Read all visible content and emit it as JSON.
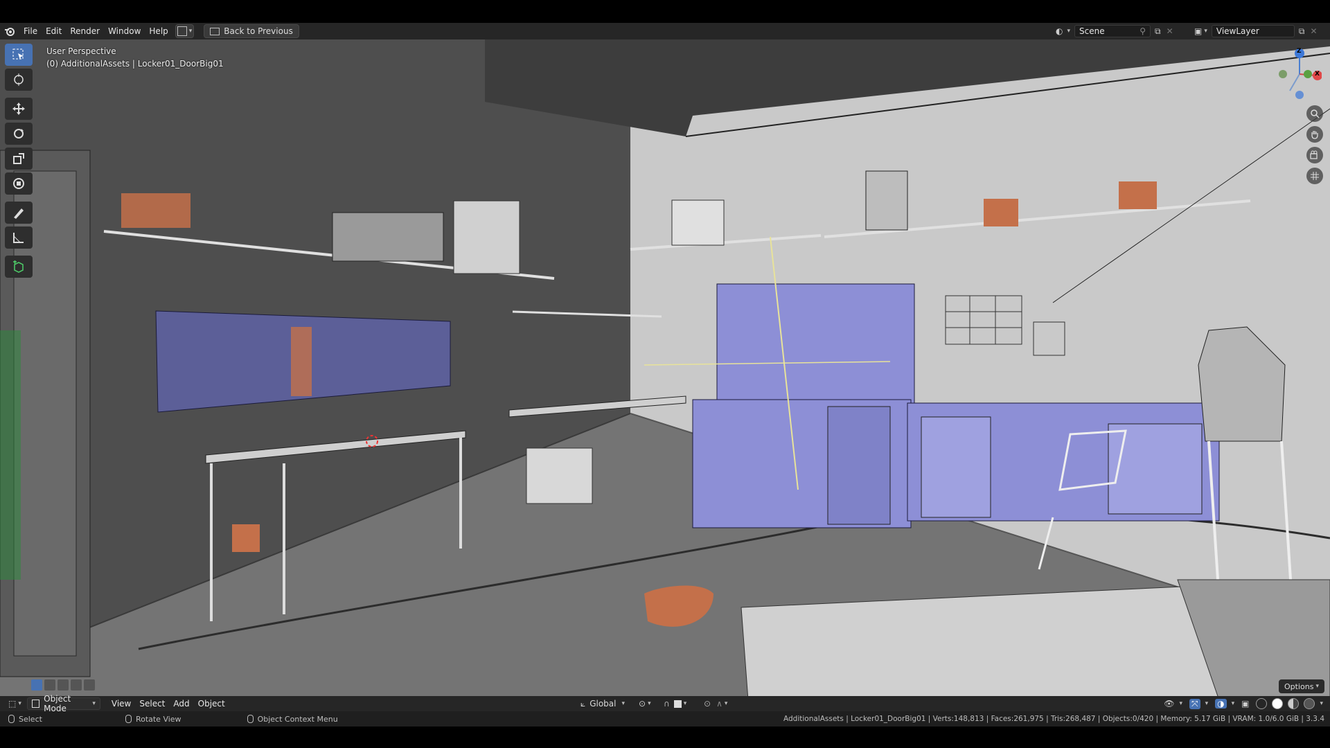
{
  "menu": {
    "file": "File",
    "edit": "Edit",
    "render": "Render",
    "window": "Window",
    "help": "Help",
    "back_to_previous": "Back to Previous"
  },
  "scene": {
    "name": "Scene"
  },
  "view_layer": {
    "name": "ViewLayer"
  },
  "viewport": {
    "perspective": "User Perspective",
    "active_object": "(0) AdditionalAssets | Locker01_DoorBig01",
    "gizmo_labels": {
      "z": "Z",
      "x": "X"
    }
  },
  "header_bottom": {
    "mode": "Object Mode",
    "view": "View",
    "select": "Select",
    "add": "Add",
    "object": "Object",
    "orientation": "Global",
    "options": "Options"
  },
  "status": {
    "hint_select": "Select",
    "hint_rotate": "Rotate View",
    "hint_context": "Object Context Menu",
    "stats": "AdditionalAssets | Locker01_DoorBig01 | Verts:148,813 | Faces:261,975 | Tris:268,487 | Objects:0/420 | Memory: 5.17 GiB | VRAM: 1.0/6.0 GiB | 3.3.4"
  },
  "colors": {
    "accent": "#4772b3",
    "selected_blue": "#8d8fd6",
    "asset_orange": "#c4704a"
  },
  "icons": [
    "blender-logo-icon",
    "select-box-icon",
    "cursor-icon",
    "move-icon",
    "rotate-icon",
    "scale-icon",
    "transform-icon",
    "annotate-icon",
    "measure-icon",
    "add-cube-icon",
    "zoom-icon",
    "pan-hand-icon",
    "camera-icon",
    "grid-ortho-icon"
  ]
}
